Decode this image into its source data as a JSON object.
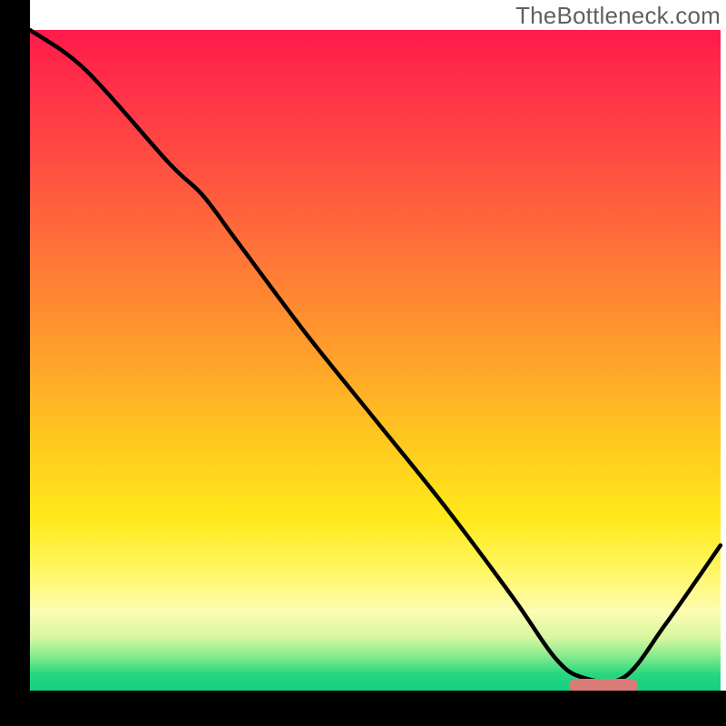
{
  "watermark": "TheBottleneck.com",
  "chart_data": {
    "type": "line",
    "title": "",
    "xlabel": "",
    "ylabel": "",
    "xlim": [
      0,
      100
    ],
    "ylim": [
      0,
      100
    ],
    "grid": false,
    "legend": false,
    "background": "vertical rainbow gradient (red→orange→yellow→green)",
    "series": [
      {
        "name": "bottleneck-curve",
        "x": [
          0,
          8,
          20,
          25,
          30,
          40,
          50,
          60,
          70,
          76,
          80,
          86,
          92,
          100
        ],
        "values": [
          100,
          94,
          80,
          75,
          68,
          54,
          41,
          28,
          14,
          5,
          2,
          2,
          10,
          22
        ]
      }
    ],
    "annotations": [
      {
        "name": "optimal-range-marker",
        "type": "pill",
        "x_range": [
          78,
          88
        ],
        "y": 0,
        "color": "#d97b77"
      }
    ],
    "gradient_stops": [
      {
        "pos": 0.0,
        "color": "#ff1a4b"
      },
      {
        "pos": 0.22,
        "color": "#ff5340"
      },
      {
        "pos": 0.5,
        "color": "#ffa22a"
      },
      {
        "pos": 0.74,
        "color": "#ffe91a"
      },
      {
        "pos": 0.88,
        "color": "#fdfcb3"
      },
      {
        "pos": 0.95,
        "color": "#7fe98c"
      },
      {
        "pos": 1.0,
        "color": "#14cf85"
      }
    ]
  }
}
